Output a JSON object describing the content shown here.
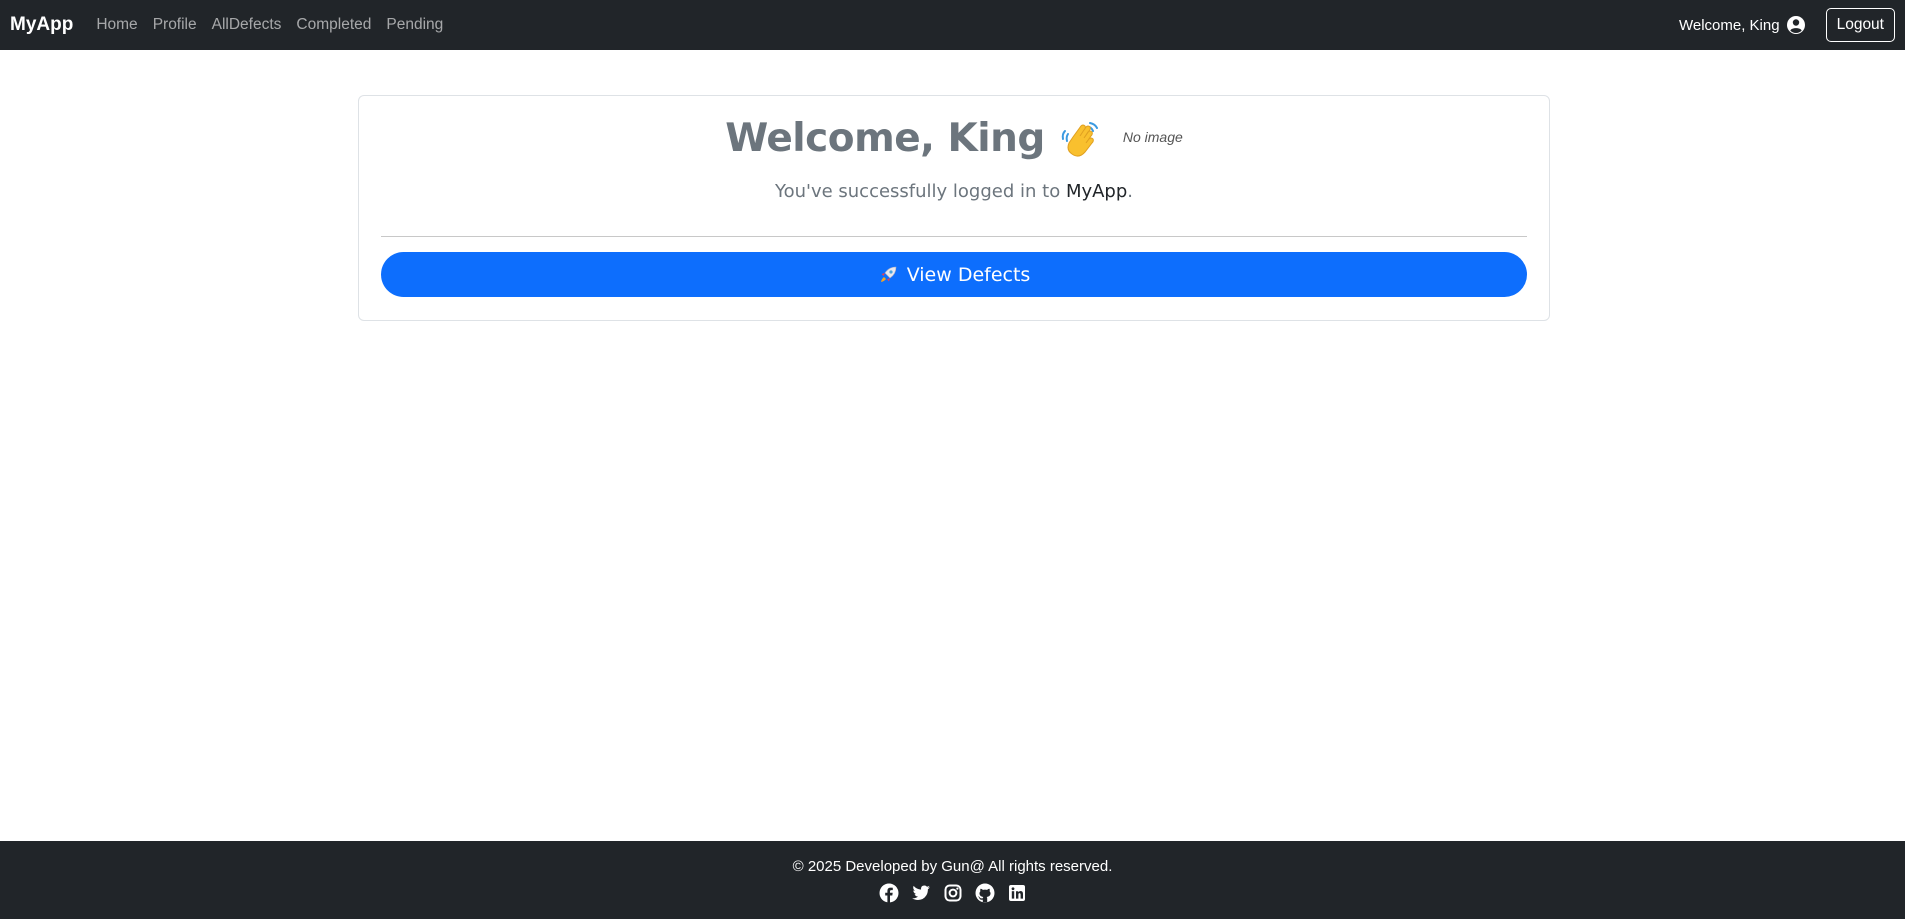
{
  "navbar": {
    "brand": "MyApp",
    "links": [
      {
        "label": "Home"
      },
      {
        "label": "Profile"
      },
      {
        "label": "AllDefects"
      },
      {
        "label": "Completed"
      },
      {
        "label": "Pending"
      }
    ],
    "welcome": "Welcome, King",
    "user_icon": "user-circle-icon",
    "logout_label": "Logout"
  },
  "card": {
    "title": "Welcome, King",
    "wave_icon": "waving-hand-icon",
    "no_image": "No image",
    "subtitle_prefix": "You've successfully logged in to ",
    "app_name": "MyApp",
    "subtitle_suffix": ".",
    "button_icon": "rocket-icon",
    "button_label": "View Defects"
  },
  "footer": {
    "copyright": "© 2025 Developed by Gun@ All rights reserved.",
    "socials": [
      "facebook-icon",
      "twitter-icon",
      "instagram-icon",
      "github-icon",
      "linkedin-icon"
    ]
  },
  "colors": {
    "navbar_bg": "#212529",
    "primary": "#0d6efd",
    "muted": "#6c757d"
  }
}
